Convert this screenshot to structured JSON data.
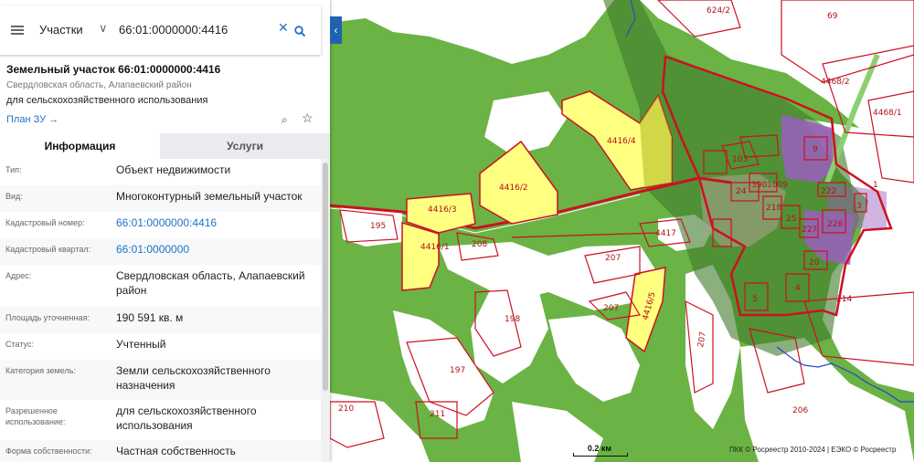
{
  "search": {
    "layer": "Участки",
    "query": "66:01:0000000:4416"
  },
  "parcel": {
    "title": "Земельный участок 66:01:0000000:4416",
    "address_short": "Свердловская область, Алапаевский район",
    "purpose": "для сельскохозяйственного использования",
    "plan_link": "План ЗУ →"
  },
  "tabs": {
    "info": "Информация",
    "services": "Услуги"
  },
  "info_rows": [
    {
      "label": "Тип:",
      "value": "Объект недвижимости"
    },
    {
      "label": "Вид:",
      "value": "Многоконтурный земельный участок"
    },
    {
      "label": "Кадастровый номер:",
      "value": "66:01:0000000:4416"
    },
    {
      "label": "Кадастровый квартал:",
      "value": "66:01:0000000"
    },
    {
      "label": "Адрес:",
      "value": "Свердловская область, Алапаевский район"
    },
    {
      "label": "Площадь уточненная:",
      "value": "190 591 кв. м"
    },
    {
      "label": "Статус:",
      "value": "Учтенный"
    },
    {
      "label": "Категория земель:",
      "value": "Земли сельскохозяйственного назначения"
    },
    {
      "label": "Разрешенное использование:",
      "value": "для сельскохозяйственного использования"
    },
    {
      "label": "Форма собственности:",
      "value": "Частная собственность"
    }
  ],
  "map": {
    "scale": "0.2 км",
    "attribution": "ПКК © Росреестр 2010-2024 | ЕЭКО © Росреестр",
    "labels": {
      "l624": "624/2",
      "l69": "69",
      "l4468_2": "4468/2",
      "l4468_1": "4468/1",
      "l4416_4": "4416/4",
      "l4416_2": "4416/2",
      "l4416_3": "4416/3",
      "l4416_1": "4416/1",
      "l4416_5": "4416/5",
      "l195": "195",
      "l208": "208",
      "l207a": "207",
      "l207b": "207",
      "l207c": "207",
      "l4417": "4417",
      "l198": "198",
      "l197": "197",
      "l210": "210",
      "l211": "211",
      "l214": "214",
      "l206": "206",
      "l103": "103",
      "l3901009": "3901009",
      "l9": "9",
      "l222": "222",
      "l24": "24",
      "l218": "218",
      "l25": "25",
      "l227": "227",
      "l226": "226",
      "l3": "3",
      "l1": "1",
      "l20": "20",
      "l5": "5",
      "l4": "4"
    }
  },
  "colors": {
    "farmland": "#ffffff",
    "forest": "#6ab344",
    "selected": "#ffff80",
    "border": "#cc1122",
    "settlement": "#9b5fbf",
    "accent": "#1e73c8"
  }
}
